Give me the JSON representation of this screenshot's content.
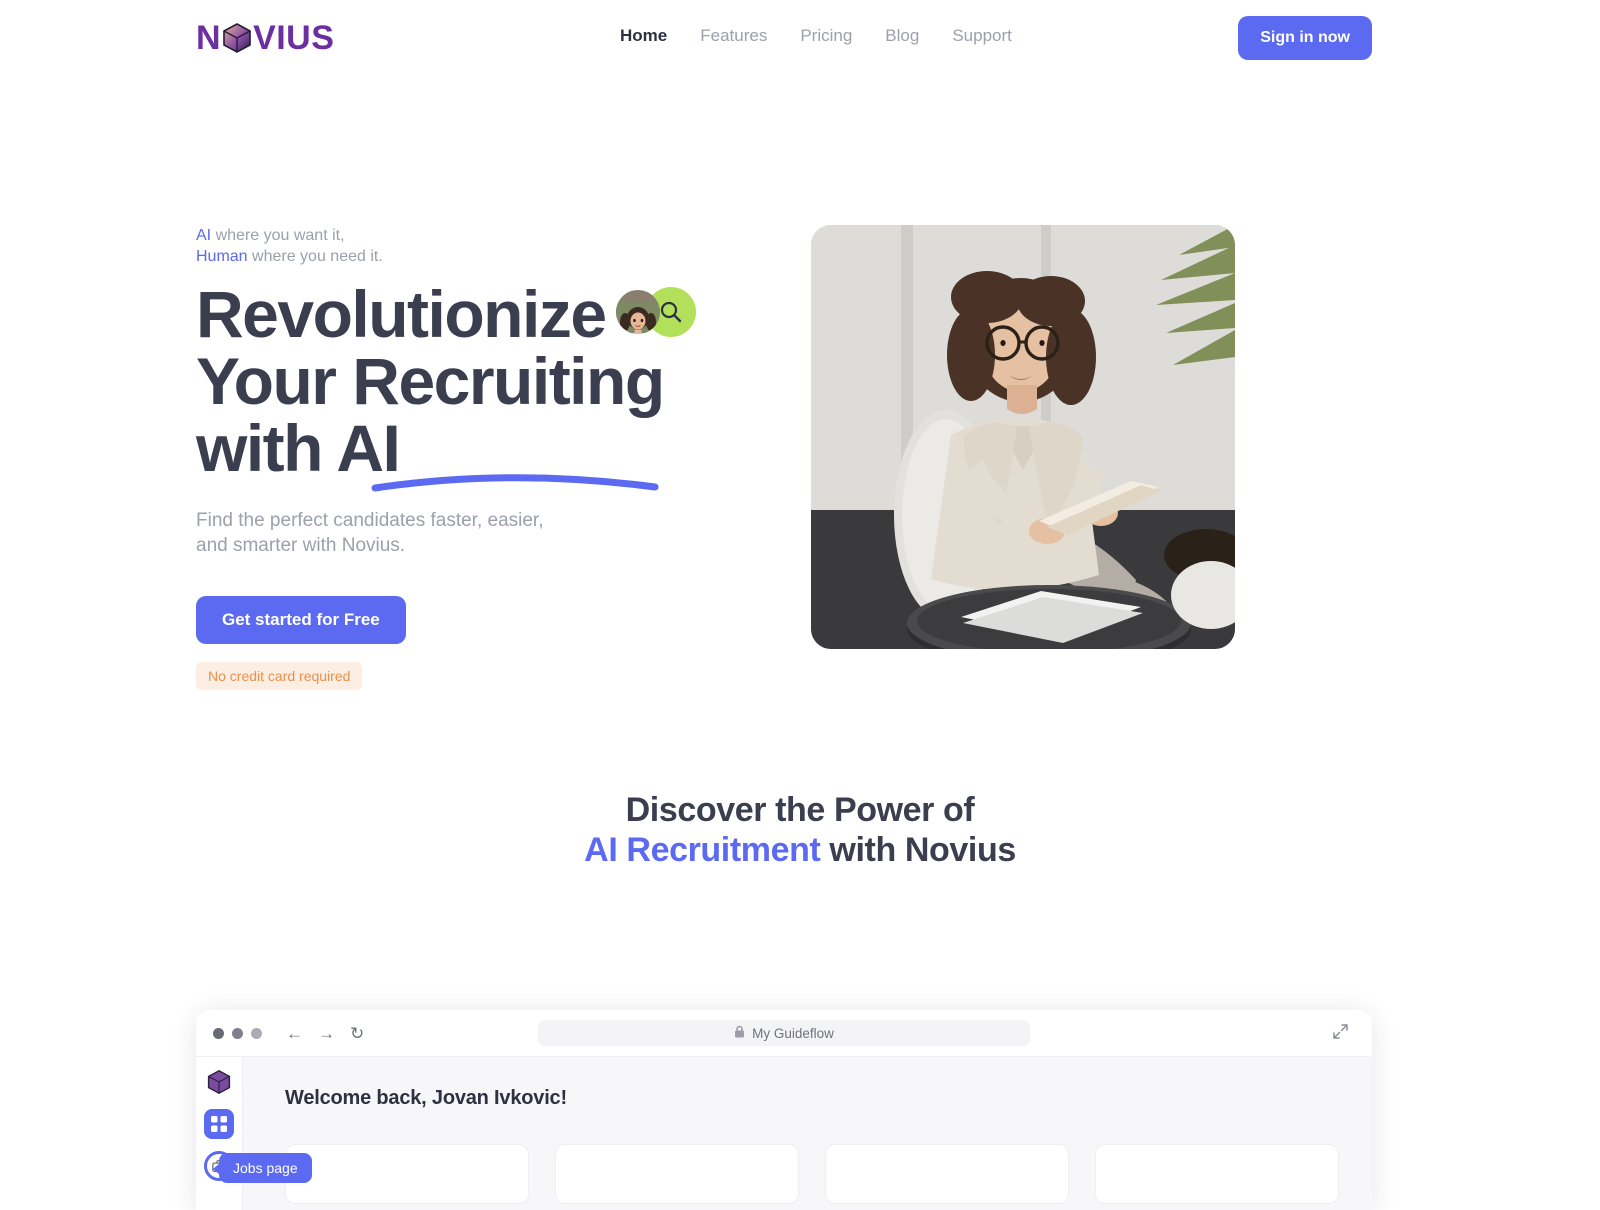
{
  "brand": {
    "name": "NOVIUS",
    "logo_icon": "cube-icon",
    "logo_color": "#6b2fa0"
  },
  "header": {
    "nav": [
      {
        "label": "Home",
        "active": true
      },
      {
        "label": "Features",
        "active": false
      },
      {
        "label": "Pricing",
        "active": false
      },
      {
        "label": "Blog",
        "active": false
      },
      {
        "label": "Support",
        "active": false
      }
    ],
    "signin_label": "Sign in now",
    "accent_color": "#5b6af0"
  },
  "hero": {
    "eyebrow_ai": "AI",
    "eyebrow_rest1": " where you want it,",
    "eyebrow_human": "Human",
    "eyebrow_rest2": " where you need it.",
    "headline_line1": "Revolutionize",
    "headline_line2": "Your Recruiting",
    "headline_line3": "with AI",
    "badge_avatar_icon": "avatar-photo",
    "badge_search_icon": "search-icon",
    "badge_search_bg": "#b3e05b",
    "subtitle": "Find the perfect candidates faster, easier, and smarter with Novius.",
    "cta_label": "Get started for Free",
    "note_label": "No credit card required",
    "note_color": "#e8904a",
    "note_bg": "#fdeee4",
    "image_alt": "Businesswoman with glasses seated in office chair holding documents"
  },
  "section": {
    "heading_line1": "Discover the Power of",
    "heading_hl": "AI Recruitment",
    "heading_rest": " with Novius",
    "hl_color": "#5b6af0"
  },
  "browser": {
    "address_label": "My Guideflow",
    "lock_icon": "lock-icon",
    "back_icon": "arrow-left-icon",
    "forward_icon": "arrow-right-icon",
    "reload_icon": "reload-icon",
    "expand_icon": "expand-icon",
    "app": {
      "welcome": "Welcome back, Jovan Ivkovic!",
      "sidebar": [
        {
          "icon": "cube-logo-icon",
          "active": false
        },
        {
          "icon": "grid-dashboard-icon",
          "active": true
        },
        {
          "icon": "briefcase-jobs-icon",
          "active": false
        }
      ],
      "tooltip_label": "Jobs page",
      "cards": [
        {},
        {},
        {},
        {}
      ]
    }
  }
}
